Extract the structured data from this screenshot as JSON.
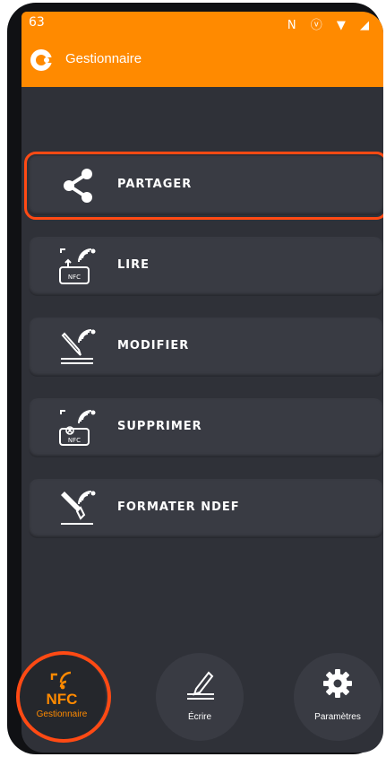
{
  "status_bar": {
    "time": "63",
    "icons": "N ⓥ ▼ ◢"
  },
  "app_bar": {
    "title": "Gestionnaire",
    "logo_icon": "app-logo-icon"
  },
  "menu": [
    {
      "label": "PARTAGER",
      "icon": "share-icon",
      "highlighted": true
    },
    {
      "label": "LIRE",
      "icon": "nfc-read-icon",
      "highlighted": false
    },
    {
      "label": "MODIFIER",
      "icon": "nfc-edit-icon",
      "highlighted": false
    },
    {
      "label": "SUPPRIMER",
      "icon": "nfc-delete-icon",
      "highlighted": false
    },
    {
      "label": "FORMATER NDEF",
      "icon": "nfc-format-icon",
      "highlighted": false
    }
  ],
  "bottom_nav": {
    "manager": {
      "icon_text": "NFC",
      "label": "Gestionnaire",
      "active": true
    },
    "write": {
      "label": "Écrire",
      "icon": "pen-write-icon"
    },
    "settings": {
      "label": "Paramètres",
      "icon": "gear-icon"
    }
  },
  "colors": {
    "accent": "#ff8a00",
    "highlight": "#ff4a14",
    "background": "#2f3138",
    "card": "#393b43"
  }
}
